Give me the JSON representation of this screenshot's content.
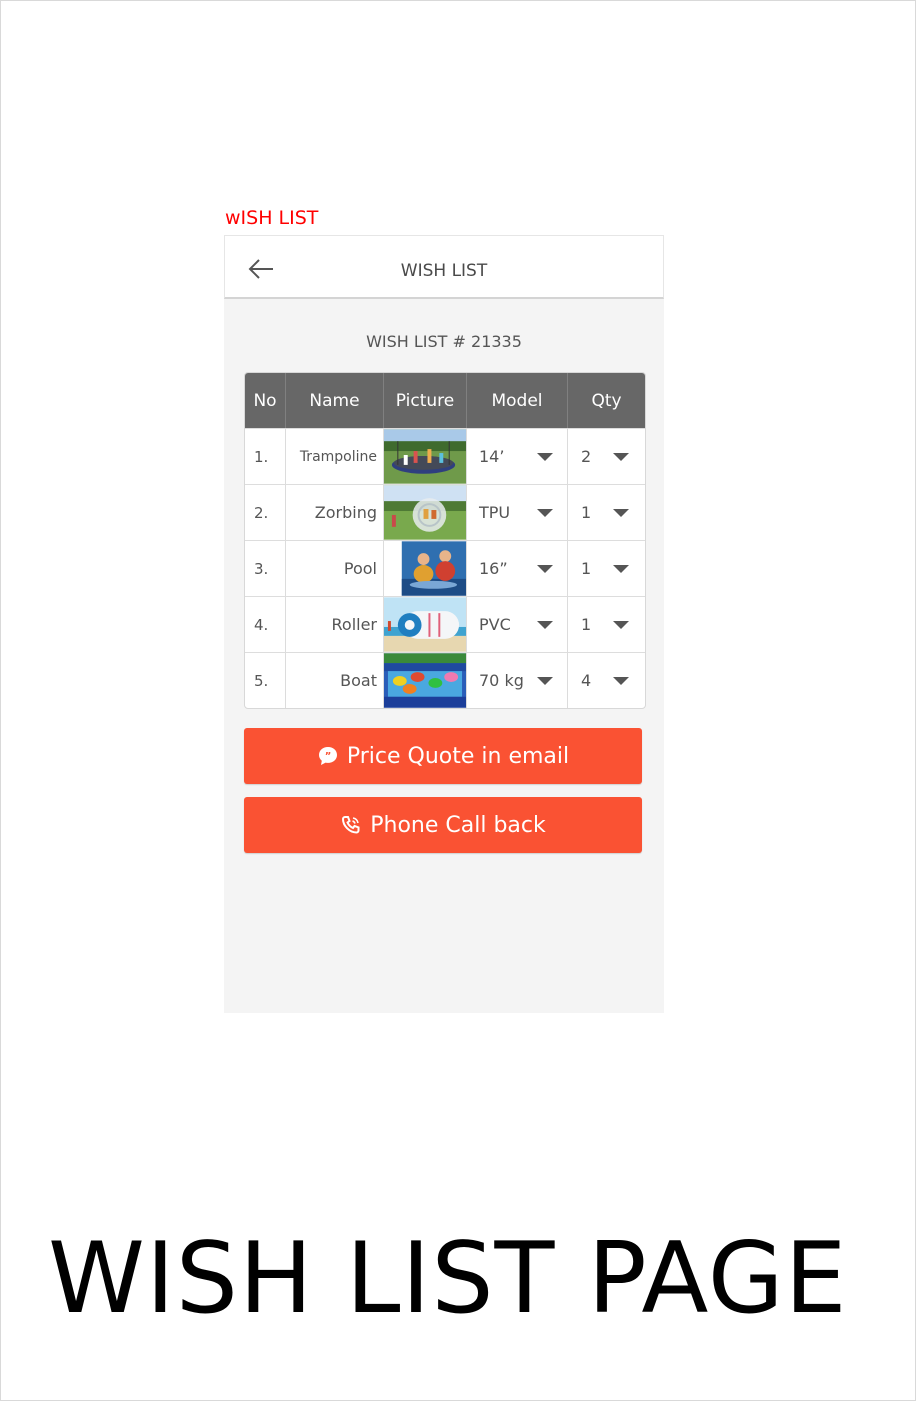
{
  "screen_label": "wISH LIST",
  "appbar": {
    "title": "WISH LIST"
  },
  "wishlist": {
    "number_label": "WISH LIST # 21335",
    "columns": [
      "No",
      "Name",
      "Picture",
      "Model",
      "Qty"
    ],
    "rows": [
      {
        "no": "1.",
        "name": "Trampoline",
        "model": "14’",
        "qty": "2"
      },
      {
        "no": "2.",
        "name": "Zorbing",
        "model": "TPU",
        "qty": "1"
      },
      {
        "no": "3.",
        "name": "Pool",
        "model": "16”",
        "qty": "1"
      },
      {
        "no": "4.",
        "name": "Roller",
        "model": "PVC",
        "qty": "1"
      },
      {
        "no": "5.",
        "name": "Boat",
        "model": "70 kg",
        "qty": "4"
      }
    ]
  },
  "buttons": {
    "email": "Price Quote in email",
    "phone": "Phone Call back"
  },
  "caption": "WISH LIST PAGE",
  "colors": {
    "accent": "#fa5233",
    "header_bg": "#676767",
    "label_red": "#ff0000"
  },
  "icons": {
    "back": "arrow-left-icon",
    "email": "chat-bubble-icon",
    "phone": "phone-icon",
    "dropdown": "caret-down-icon"
  }
}
